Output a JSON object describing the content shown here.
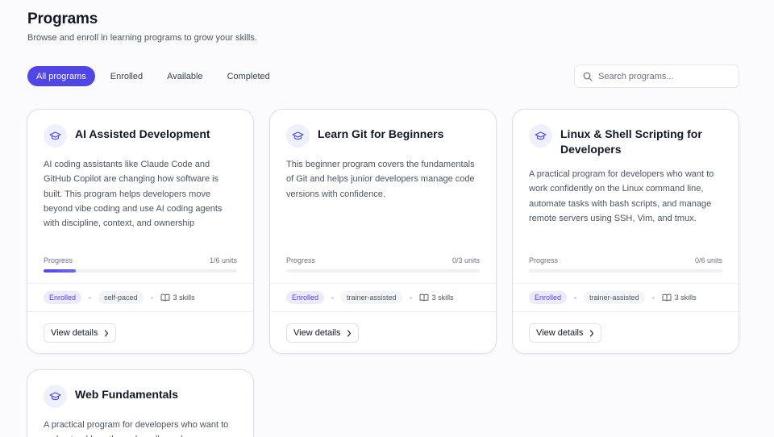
{
  "page": {
    "title": "Programs",
    "subtitle": "Browse and enroll in learning programs to grow your skills."
  },
  "tabs": [
    {
      "label": "All programs",
      "active": true
    },
    {
      "label": "Enrolled",
      "active": false
    },
    {
      "label": "Available",
      "active": false
    },
    {
      "label": "Completed",
      "active": false
    }
  ],
  "search": {
    "placeholder": "Search programs...",
    "value": ""
  },
  "colors": {
    "accent": "#4f46e5",
    "card_border": "#dcdcf5"
  },
  "icons": {
    "program": "graduation-cap-icon",
    "search": "search-icon",
    "skills": "book-open-icon",
    "details": "chevron-right-icon"
  },
  "programs": [
    {
      "title": "AI Assisted Development",
      "description": "AI coding assistants like Claude Code and GitHub Copilot are changing how software is built. This program helps developers move beyond vibe coding and use AI coding agents with discipline, context, and ownership",
      "progress_label": "Progress",
      "progress_text": "1/6 units",
      "progress_fraction": 0.1667,
      "status": "Enrolled",
      "pace": "self-paced",
      "skills": "3 skills",
      "action": "View details"
    },
    {
      "title": "Learn Git for Beginners",
      "description": "This beginner program covers the fundamentals of Git and helps junior developers manage code versions with confidence.",
      "progress_label": "Progress",
      "progress_text": "0/3 units",
      "progress_fraction": 0,
      "status": "Enrolled",
      "pace": "trainer-assisted",
      "skills": "3 skills",
      "action": "View details"
    },
    {
      "title": "Linux & Shell Scripting for Developers",
      "description": "A practical program for developers who want to work confidently on the Linux command line, automate tasks with bash scripts, and manage remote servers using SSH, Vim, and tmux.",
      "progress_label": "Progress",
      "progress_text": "0/6 units",
      "progress_fraction": 0,
      "status": "Enrolled",
      "pace": "trainer-assisted",
      "skills": "3 skills",
      "action": "View details"
    },
    {
      "title": "Web Fundamentals",
      "description": "A practical program for developers who want to understand how the web really works",
      "progress_label": "",
      "progress_text": "",
      "progress_fraction": 0,
      "status": "",
      "pace": "",
      "skills": "",
      "action": ""
    }
  ]
}
